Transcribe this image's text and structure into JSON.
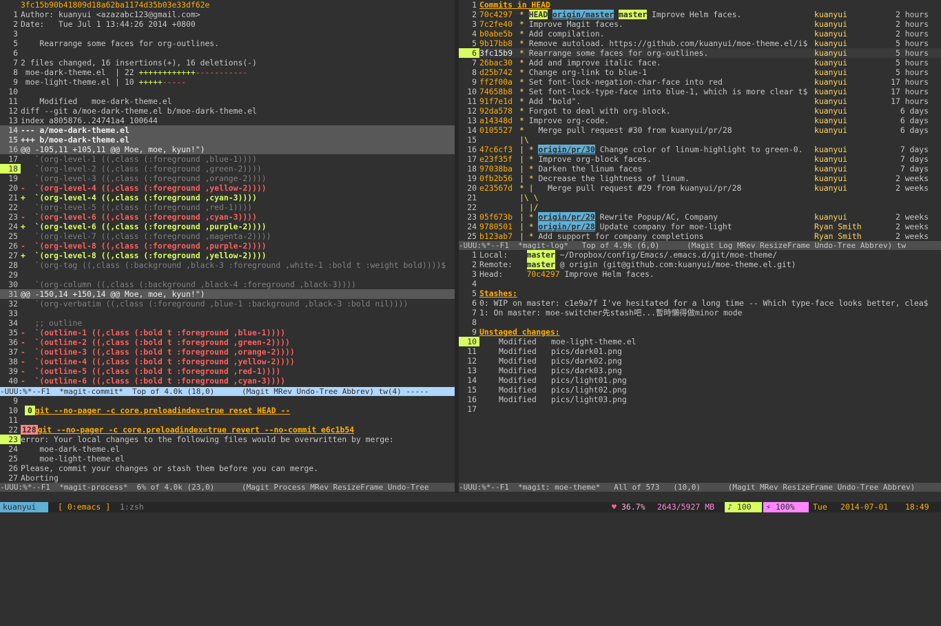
{
  "commit_pane": {
    "lines": [
      {
        "n": "",
        "t": "3fc15b90b41809d18a62ba1174d35b03e33df62e",
        "c": "orange"
      },
      {
        "n": "1",
        "t": "Author: kuanyui <azazabc123@gmail.com>",
        "c": ""
      },
      {
        "n": "2",
        "t": "Date:   Tue Jul 1 13:44:26 2014 +0800",
        "c": ""
      },
      {
        "n": "3",
        "t": "",
        "c": ""
      },
      {
        "n": "5",
        "t": "    Rearrange some faces for org-outlines.",
        "c": ""
      },
      {
        "n": "6",
        "t": "",
        "c": ""
      },
      {
        "n": "7",
        "t": "2 files changed, 16 insertions(+), 16 deletions(-)",
        "c": ""
      },
      {
        "n": "8",
        "t": " moe-dark-theme.el  | 22 ++++++++++++-----------",
        "c": "stat"
      },
      {
        "n": "9",
        "t": " moe-light-theme.el | 10 +++++-----",
        "c": "stat"
      },
      {
        "n": "10",
        "t": "",
        "c": ""
      },
      {
        "n": "11",
        "t": "    Modified   moe-dark-theme.el",
        "c": ""
      },
      {
        "n": "12",
        "t": "diff --git a/moe-dark-theme.el b/moe-dark-theme.el",
        "c": ""
      },
      {
        "n": "13",
        "t": "index a805876..24741a4 100644",
        "c": ""
      },
      {
        "n": "14",
        "t": "--- a/moe-dark-theme.el",
        "c": "sel"
      },
      {
        "n": "15",
        "t": "+++ b/moe-dark-theme.el",
        "c": "sel"
      },
      {
        "n": "16",
        "t": "@@ -105,11 +105,11 @@ Moe, moe, kyun!\")",
        "c": "hunk"
      },
      {
        "n": "17",
        "t": "   `(org-level-1 ((,class (:foreground ,blue-1))))",
        "c": "ctx"
      },
      {
        "n": "18",
        "t": "   `(org-level-2 ((,class (:foreground ,green-2))))",
        "c": "ctx",
        "cur": true
      },
      {
        "n": "19",
        "t": "   `(org-level-3 ((,class (:foreground ,orange-2))))",
        "c": "ctx"
      },
      {
        "n": "20",
        "t": "-  `(org-level-4 ((,class (:foreground ,yellow-2))))",
        "c": "del"
      },
      {
        "n": "21",
        "t": "+  `(org-level-4 ((,class (:foreground ,cyan-3))))",
        "c": "add"
      },
      {
        "n": "22",
        "t": "   `(org-level-5 ((,class (:foreground ,red-1))))",
        "c": "ctx"
      },
      {
        "n": "23",
        "t": "-  `(org-level-6 ((,class (:foreground ,cyan-3))))",
        "c": "del"
      },
      {
        "n": "24",
        "t": "+  `(org-level-6 ((,class (:foreground ,purple-2))))",
        "c": "add"
      },
      {
        "n": "25",
        "t": "   `(org-level-7 ((,class (:foreground ,magenta-2))))",
        "c": "ctx"
      },
      {
        "n": "26",
        "t": "-  `(org-level-8 ((,class (:foreground ,purple-2))))",
        "c": "del"
      },
      {
        "n": "27",
        "t": "+  `(org-level-8 ((,class (:foreground ,yellow-2))))",
        "c": "add"
      },
      {
        "n": "28",
        "t": "   `(org-tag ((,class (:background ,black-3 :foreground ,white-1 :bold t :weight bold))))$",
        "c": "ctx"
      },
      {
        "n": "29",
        "t": "",
        "c": "ctx"
      },
      {
        "n": "30",
        "t": "   `(org-column ((,class (:background ,black-4 :foreground ,black-3))))",
        "c": "ctx"
      },
      {
        "n": "31",
        "t": "@@ -150,14 +150,14 @@ Moe, moe, kyun!\")",
        "c": "hunk"
      },
      {
        "n": "32",
        "t": "   `(org-verbatim ((,class (:foreground ,blue-1 :background ,black-3 :bold nil))))",
        "c": "ctx"
      },
      {
        "n": "33",
        "t": "",
        "c": "ctx"
      },
      {
        "n": "34",
        "t": "   ;; outline",
        "c": "ctx"
      },
      {
        "n": "35",
        "t": "-  `(outline-1 ((,class (:bold t :foreground ,blue-1))))",
        "c": "del"
      },
      {
        "n": "36",
        "t": "-  `(outline-2 ((,class (:bold t :foreground ,green-2))))",
        "c": "del"
      },
      {
        "n": "37",
        "t": "-  `(outline-3 ((,class (:bold t :foreground ,orange-2))))",
        "c": "del"
      },
      {
        "n": "38",
        "t": "-  `(outline-4 ((,class (:bold t :foreground ,yellow-2))))",
        "c": "del"
      },
      {
        "n": "39",
        "t": "-  `(outline-5 ((,class (:bold t :foreground ,red-1))))",
        "c": "del"
      },
      {
        "n": "40",
        "t": "-  `(outline-6 ((,class (:bold t :foreground ,cyan-3))))",
        "c": "del"
      }
    ],
    "modeline": "-UUU:%*--F1  *magit-commit*  Top of 4.0k (18,0)      (Magit MRev Undo-Tree Abbrev) tw(4) -----"
  },
  "process_pane": {
    "lines": [
      {
        "n": "9",
        "t": "",
        "badge": "",
        "c": ""
      },
      {
        "n": "10",
        "t": "git --no-pager -c core.preloadindex=true reset HEAD --",
        "badge": "0",
        "c": "ok"
      },
      {
        "n": "11",
        "t": "",
        "badge": "",
        "c": ""
      },
      {
        "n": "22",
        "t": "git --no-pager -c core.preloadindex=true revert --no-commit e6c1b54",
        "badge": "128",
        "c": "err"
      },
      {
        "n": "23",
        "t": "error: Your local changes to the following files would be overwritten by merge:",
        "badge": "",
        "c": "",
        "cur": true
      },
      {
        "n": "24",
        "t": "    moe-dark-theme.el",
        "badge": "",
        "c": ""
      },
      {
        "n": "25",
        "t": "    moe-light-theme.el",
        "badge": "",
        "c": ""
      },
      {
        "n": "26",
        "t": "Please, commit your changes or stash them before you can merge.",
        "badge": "",
        "c": ""
      },
      {
        "n": "27",
        "t": "Aborting",
        "badge": "",
        "c": ""
      }
    ],
    "modeline": "-UUU:%*--F1  *magit-process*  6% of 4.0k (23,0)      (Magit Process MRev ResizeFrame Undo-Tree"
  },
  "log_pane": {
    "header": {
      "n": "1",
      "t": "Commits in HEAD"
    },
    "rows": [
      {
        "n": "2",
        "sha": "70c4297",
        "graph": "* ",
        "refs": [
          {
            "t": "HEAD",
            "k": "head"
          },
          {
            "t": "origin/master",
            "k": "remote"
          },
          {
            "t": "master",
            "k": "local"
          }
        ],
        "msg": "Improve Helm faces.",
        "author": "kuanyui",
        "age": "2 hours"
      },
      {
        "n": "3",
        "sha": "7c2fe40",
        "graph": "* ",
        "refs": [],
        "msg": "Improve Magit faces.",
        "author": "kuanyui",
        "age": "2 hours"
      },
      {
        "n": "4",
        "sha": "b0abe5b",
        "graph": "* ",
        "refs": [],
        "msg": "Add compilation.",
        "author": "kuanyui",
        "age": "2 hours"
      },
      {
        "n": "5",
        "sha": "9b17bb8",
        "graph": "* ",
        "refs": [],
        "msg": "Remove autoload. https://github.com/kuanyui/moe-theme.el/i$",
        "author": "kuanyui",
        "age": "5 hours"
      },
      {
        "n": "6",
        "sha": "3fc15b9",
        "graph": "* ",
        "refs": [],
        "msg": "Rearrange some faces for org-outlines.",
        "author": "kuanyui",
        "age": "5 hours",
        "cur": true
      },
      {
        "n": "7",
        "sha": "26bac30",
        "graph": "* ",
        "refs": [],
        "msg": "Add and improve italic face.",
        "author": "kuanyui",
        "age": "5 hours"
      },
      {
        "n": "8",
        "sha": "d25b742",
        "graph": "* ",
        "refs": [],
        "msg": "Change org-link to blue-1",
        "author": "kuanyui",
        "age": "5 hours"
      },
      {
        "n": "9",
        "sha": "ff2f00a",
        "graph": "* ",
        "refs": [],
        "msg": "Set font-lock-negation-char-face into red",
        "author": "kuanyui",
        "age": "17 hours"
      },
      {
        "n": "10",
        "sha": "74658b8",
        "graph": "* ",
        "refs": [],
        "msg": "Set font-lock-type-face into blue-1, which is more clear t$",
        "author": "kuanyui",
        "age": "17 hours"
      },
      {
        "n": "11",
        "sha": "91f7e1d",
        "graph": "* ",
        "refs": [],
        "msg": "Add \"bold\".",
        "author": "kuanyui",
        "age": "17 hours"
      },
      {
        "n": "12",
        "sha": "92da578",
        "graph": "* ",
        "refs": [],
        "msg": "Forgot to deal with org-block.",
        "author": "kuanyui",
        "age": "6 days"
      },
      {
        "n": "13",
        "sha": "a14348d",
        "graph": "* ",
        "refs": [],
        "msg": "Improve org-code.",
        "author": "kuanyui",
        "age": "6 days"
      },
      {
        "n": "14",
        "sha": "0105527",
        "graph": "*   ",
        "refs": [],
        "msg": "Merge pull request #30 from kuanyui/pr/28",
        "author": "kuanyui",
        "age": "6 days"
      },
      {
        "n": "15",
        "sha": "",
        "graph": "|\\",
        "refs": [],
        "msg": "",
        "author": "",
        "age": ""
      },
      {
        "n": "16",
        "sha": "47c6cf3",
        "graph": "| * ",
        "refs": [
          {
            "t": "origin/pr/30",
            "k": "remote"
          }
        ],
        "msg": "Change color of linum-highlight to green-0.",
        "author": "kuanyui",
        "age": "7 days"
      },
      {
        "n": "17",
        "sha": "e23f35f",
        "graph": "| * ",
        "refs": [],
        "msg": "Improve org-block faces.",
        "author": "kuanyui",
        "age": "7 days"
      },
      {
        "n": "18",
        "sha": "97038ba",
        "graph": "| * ",
        "refs": [],
        "msg": "Darken the linum faces",
        "author": "kuanyui",
        "age": "7 days"
      },
      {
        "n": "19",
        "sha": "0fb2b56",
        "graph": "| * ",
        "refs": [],
        "msg": "Decrease the lightness of linum.",
        "author": "kuanyui",
        "age": "2 weeks"
      },
      {
        "n": "20",
        "sha": "e23567d",
        "graph": "* |   ",
        "refs": [],
        "msg": "Merge pull request #29 from kuanyui/pr/28",
        "author": "kuanyui",
        "age": "2 weeks"
      },
      {
        "n": "21",
        "sha": "",
        "graph": "|\\ \\",
        "refs": [],
        "msg": "",
        "author": "",
        "age": ""
      },
      {
        "n": "22",
        "sha": "",
        "graph": "| |/",
        "refs": [],
        "msg": "",
        "author": "",
        "age": ""
      },
      {
        "n": "23",
        "sha": "05f673b",
        "graph": "| * ",
        "refs": [
          {
            "t": "origin/pr/29",
            "k": "remote"
          }
        ],
        "msg": "Rewrite Popup/AC, Company",
        "author": "kuanyui",
        "age": "2 weeks"
      },
      {
        "n": "24",
        "sha": "9780501",
        "graph": "| * ",
        "refs": [
          {
            "t": "origin/pr/28",
            "k": "remote"
          }
        ],
        "msg": "Update company for moe-light",
        "author": "Ryan Smith",
        "age": "2 weeks"
      },
      {
        "n": "25",
        "sha": "b123ab7",
        "graph": "| * ",
        "refs": [],
        "msg": "Add support for company completions",
        "author": "Ryan Smith",
        "age": "2 weeks"
      }
    ],
    "modeline": "-UUU:%*--F1  *magit-log*   Top of 4.9k (6,0)      (Magit Log MRev ResizeFrame Undo-Tree Abbrev) tw"
  },
  "status_pane": {
    "local_label": "Local:",
    "local_branch": "master",
    "local_path": "~/Dropbox/config/Emacs/.emacs.d/git/moe-theme/",
    "remote_label": "Remote:",
    "remote_branch": "master",
    "remote_path": "@ origin (git@github.com:kuanyui/moe-theme.el.git)",
    "head_label": "Head:",
    "head_sha": "70c4297",
    "head_msg": "Improve Helm faces.",
    "line5": {
      "n": "5",
      "t": "Stashes:"
    },
    "stashes": [
      "0: WIP on master: c1e9a7f I've hesitated for a long time -- Which type-face looks better, clea$",
      "1: On master: moe-switcher先stash吧...暫時懶得做minor mode"
    ],
    "unstaged_title": "Unstaged changes:",
    "unstaged": [
      {
        "n": "10",
        "status": "Modified",
        "file": "moe-light-theme.el",
        "cur": true
      },
      {
        "n": "11",
        "status": "Modified",
        "file": "pics/dark01.png"
      },
      {
        "n": "12",
        "status": "Modified",
        "file": "pics/dark02.png"
      },
      {
        "n": "13",
        "status": "Modified",
        "file": "pics/dark03.png"
      },
      {
        "n": "14",
        "status": "Modified",
        "file": "pics/light01.png"
      },
      {
        "n": "15",
        "status": "Modified",
        "file": "pics/light02.png"
      },
      {
        "n": "16",
        "status": "Modified",
        "file": "pics/light03.png"
      },
      {
        "n": "17",
        "status": "",
        "file": ""
      }
    ],
    "modeline": "-UUU:%*--F1  *magit: moe-theme*   All of 573   (10,0)      (Magit MRev ResizeFrame Undo-Tree Abbrev)"
  },
  "statusbar": {
    "user": "kuanyui",
    "window_active": "[ 0:emacs ]",
    "window_other": "1:zsh",
    "heart": "♥",
    "cpu": "36.7%",
    "mem": "2643/5927 MB",
    "music": "♪ 100",
    "battery": "⚡ 100%",
    "day": "Tue",
    "date": "2014-07-01",
    "time": "18:49"
  },
  "colors": {
    "bg": "#303030",
    "accent_green": "#d7ff5f",
    "accent_orange": "#ffaf00",
    "accent_blue": "#5fafd7",
    "accent_red": "#ff5f5f"
  }
}
